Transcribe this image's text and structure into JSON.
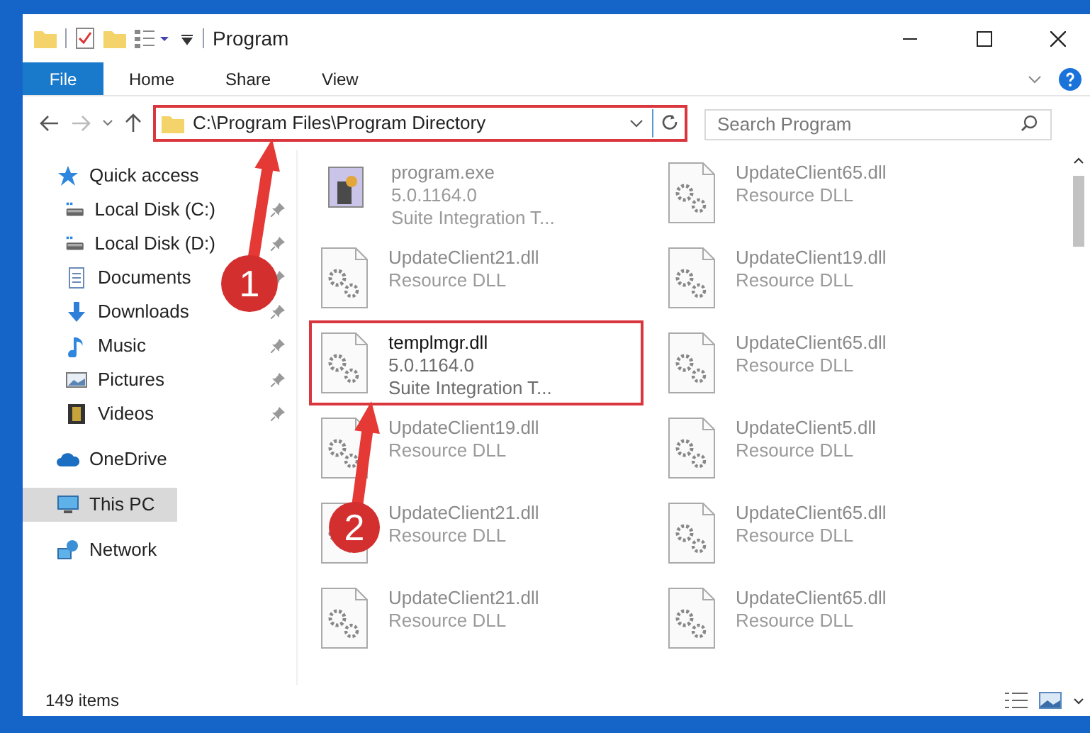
{
  "window": {
    "title": "Program"
  },
  "ribbon_tabs": [
    {
      "label": "File",
      "selected": true
    },
    {
      "label": "Home",
      "selected": false
    },
    {
      "label": "Share",
      "selected": false
    },
    {
      "label": "View",
      "selected": false
    }
  ],
  "address_bar": {
    "path": "C:\\Program Files\\Program Directory",
    "highlighted": true
  },
  "search": {
    "placeholder": "Search Program"
  },
  "sidebar": {
    "items": [
      {
        "label": "Quick access",
        "kind": "star",
        "pinned": false,
        "selected": false
      },
      {
        "label": "Local Disk (C:)",
        "kind": "disk",
        "pinned": true,
        "selected": false
      },
      {
        "label": "Local Disk (D:)",
        "kind": "disk",
        "pinned": true,
        "selected": false
      },
      {
        "label": "Documents",
        "kind": "document",
        "pinned": true,
        "selected": false
      },
      {
        "label": "Downloads",
        "kind": "download",
        "pinned": true,
        "selected": false
      },
      {
        "label": "Music",
        "kind": "music",
        "pinned": true,
        "selected": false
      },
      {
        "label": "Pictures",
        "kind": "pictures",
        "pinned": true,
        "selected": false
      },
      {
        "label": "Videos",
        "kind": "videos",
        "pinned": true,
        "selected": false
      },
      {
        "label": "OneDrive",
        "kind": "cloud",
        "pinned": false,
        "selected": false
      },
      {
        "label": "This PC",
        "kind": "computer",
        "pinned": false,
        "selected": true
      },
      {
        "label": "Network",
        "kind": "network",
        "pinned": false,
        "selected": false
      }
    ]
  },
  "files": [
    {
      "kind": "exe",
      "name": "program.exe",
      "lines": [
        "5.0.1164.0",
        "Suite Integration T..."
      ],
      "faded": true,
      "highlighted": false
    },
    {
      "kind": "dll",
      "name": "UpdateClient65.dll",
      "lines": [
        "Resource DLL"
      ],
      "faded": true,
      "highlighted": false
    },
    {
      "kind": "dll",
      "name": "UpdateClient21.dll",
      "lines": [
        "Resource DLL"
      ],
      "faded": true,
      "highlighted": false
    },
    {
      "kind": "dll",
      "name": "UpdateClient19.dll",
      "lines": [
        "Resource DLL"
      ],
      "faded": true,
      "highlighted": false
    },
    {
      "kind": "dll",
      "name": "templmgr.dll",
      "lines": [
        "5.0.1164.0",
        "Suite Integration T..."
      ],
      "faded": false,
      "highlighted": true
    },
    {
      "kind": "dll",
      "name": "UpdateClient65.dll",
      "lines": [
        "Resource DLL"
      ],
      "faded": true,
      "highlighted": false
    },
    {
      "kind": "dll",
      "name": "UpdateClient19.dll",
      "lines": [
        "Resource DLL"
      ],
      "faded": true,
      "highlighted": false
    },
    {
      "kind": "dll",
      "name": "UpdateClient5.dll",
      "lines": [
        "Resource DLL"
      ],
      "faded": true,
      "highlighted": false
    },
    {
      "kind": "dll",
      "name": "UpdateClient21.dll",
      "lines": [
        "Resource DLL"
      ],
      "faded": true,
      "highlighted": false
    },
    {
      "kind": "dll",
      "name": "UpdateClient65.dll",
      "lines": [
        "Resource DLL"
      ],
      "faded": true,
      "highlighted": false
    },
    {
      "kind": "dll",
      "name": "UpdateClient21.dll",
      "lines": [
        "Resource DLL"
      ],
      "faded": true,
      "highlighted": false
    },
    {
      "kind": "dll",
      "name": "UpdateClient65.dll",
      "lines": [
        "Resource DLL"
      ],
      "faded": true,
      "highlighted": false
    }
  ],
  "status_bar": {
    "item_count": "149 items"
  },
  "annotations": [
    {
      "number": "1"
    },
    {
      "number": "2"
    }
  ]
}
